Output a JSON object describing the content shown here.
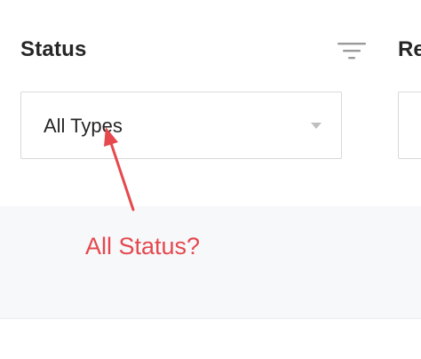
{
  "header": {
    "title": "Status",
    "next_title": "Re",
    "filter_icon": "filter-lines-icon"
  },
  "status_select": {
    "value": "All Types",
    "caret_icon": "caret-down-icon"
  },
  "annotation": {
    "text": "All Status?",
    "color": "#e5484d",
    "arrow_icon": "red-arrow-icon"
  },
  "colors": {
    "text": "#262626",
    "border": "#d9d9d9",
    "band": "#f7f8fa"
  }
}
